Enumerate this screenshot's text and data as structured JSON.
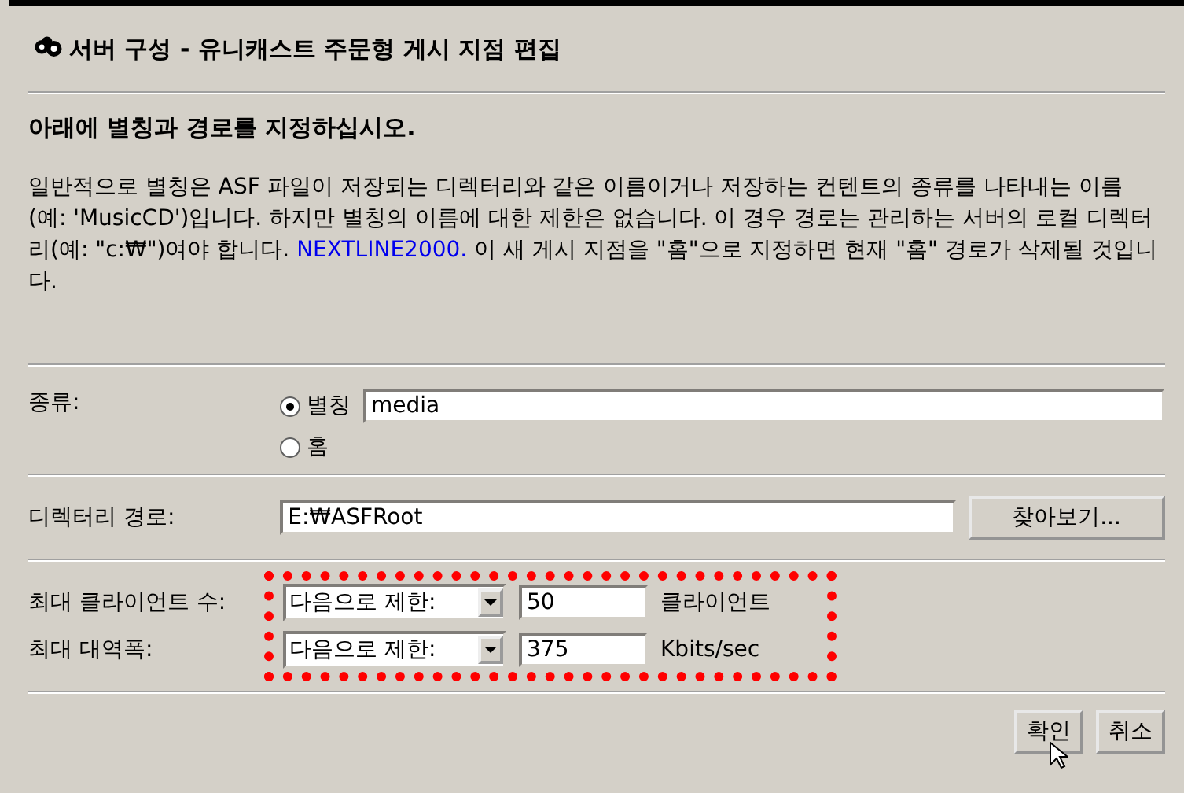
{
  "window": {
    "title": "서버 구성 -  유니캐스트 주문형 게시 지점 편집"
  },
  "heading": "아래에 별칭과 경로를 지정하십시오.",
  "description": {
    "text": "일반적으로 별칭은 ASF 파일이 저장되는 디렉터리와 같은 이름이거나 저장하는 컨텐트의 종류를 나타내는 이름(예: 'MusicCD')입니다. 하지만 별칭의 이름에 대한 제한은 없습니다. 이 경우 경로는 관리하는 서버의 로컬 디렉터리(예: \"c:₩\")여야 합니다.",
    "link": "NEXTLINE2000.",
    "after": " 이 새 게시 지점을 \"홈\"으로 지정하면 현재 \"홈\" 경로가 삭제될 것입니다."
  },
  "type": {
    "label": "종류:",
    "options": [
      {
        "label": "별칭",
        "selected": true,
        "value": "media"
      },
      {
        "label": "홈",
        "selected": false
      }
    ]
  },
  "directory": {
    "label": "디렉터리 경로:",
    "value": "E:₩ASFRoot",
    "browse": "찾아보기..."
  },
  "limits": [
    {
      "label": "최대 클라이언트 수:",
      "mode": "다음으로 제한:",
      "value": "50",
      "unit": "클라이언트"
    },
    {
      "label": "최대 대역폭:",
      "mode": "다음으로 제한:",
      "value": "375",
      "unit": "Kbits/sec"
    }
  ],
  "buttons": [
    "확인",
    "취소"
  ]
}
